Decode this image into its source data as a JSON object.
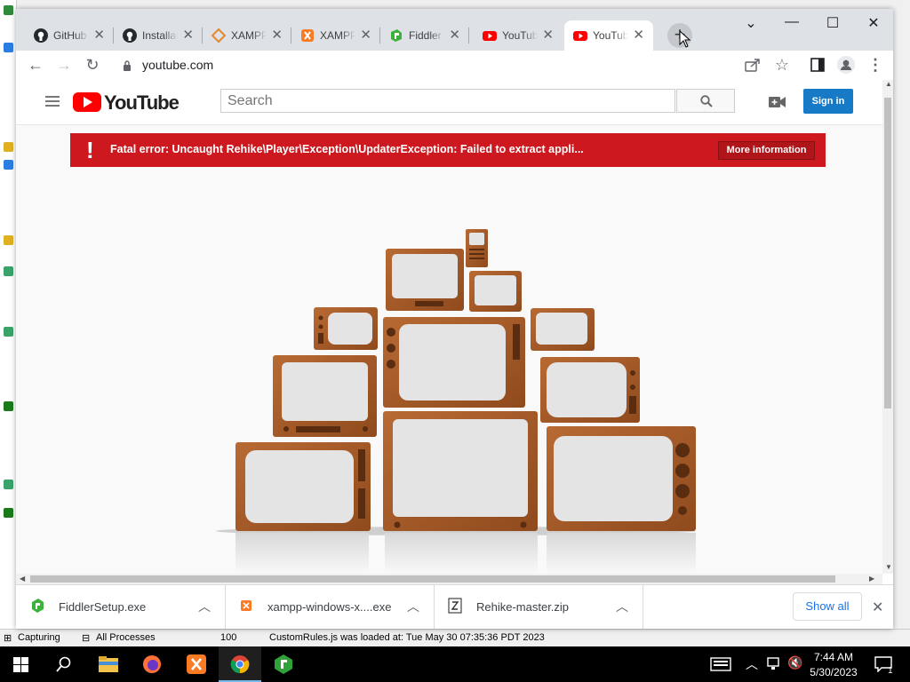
{
  "chrome": {
    "tabs": [
      {
        "label": "GitHub",
        "icon": "github-icon"
      },
      {
        "label": "Installation",
        "icon": "github-icon"
      },
      {
        "label": "XAMPP",
        "icon": "xampp-diamond-icon"
      },
      {
        "label": "XAMPP",
        "icon": "xampp-icon"
      },
      {
        "label": "Fiddler",
        "icon": "fiddler-icon"
      },
      {
        "label": "YouTube",
        "icon": "youtube-icon"
      },
      {
        "label": "YouTube",
        "icon": "youtube-icon",
        "active": true
      }
    ],
    "new_tab_label": "+",
    "url": "youtube.com"
  },
  "youtube": {
    "logo_text": "YouTube",
    "search_placeholder": "Search",
    "signin_label": "Sign in",
    "error_message": "Fatal error: Uncaught Rehike\\Player\\Exception\\UpdaterException: Failed to extract appli...",
    "error_icon": "!",
    "more_info_label": "More information"
  },
  "downloads": {
    "items": [
      {
        "name": "FiddlerSetup.exe",
        "icon": "fiddler-icon"
      },
      {
        "name": "xampp-windows-x....exe",
        "icon": "xampp-icon"
      },
      {
        "name": "Rehike-master.zip",
        "icon": "zip-icon"
      }
    ],
    "show_all_label": "Show all"
  },
  "fiddler_status": {
    "capturing": "Capturing",
    "processes": "All Processes",
    "count": "100",
    "message": "CustomRules.js was loaded at: Tue May 30 07:35:36 PDT 2023"
  },
  "taskbar": {
    "time": "7:44 AM",
    "date": "5/30/2023",
    "notification_count": "1"
  },
  "colors": {
    "youtube_red": "#ff0000",
    "error_bar": "#cc181e",
    "signin_blue": "#167ac6",
    "tab_strip": "#dee1e6",
    "tv_wood": "#a0592a"
  }
}
